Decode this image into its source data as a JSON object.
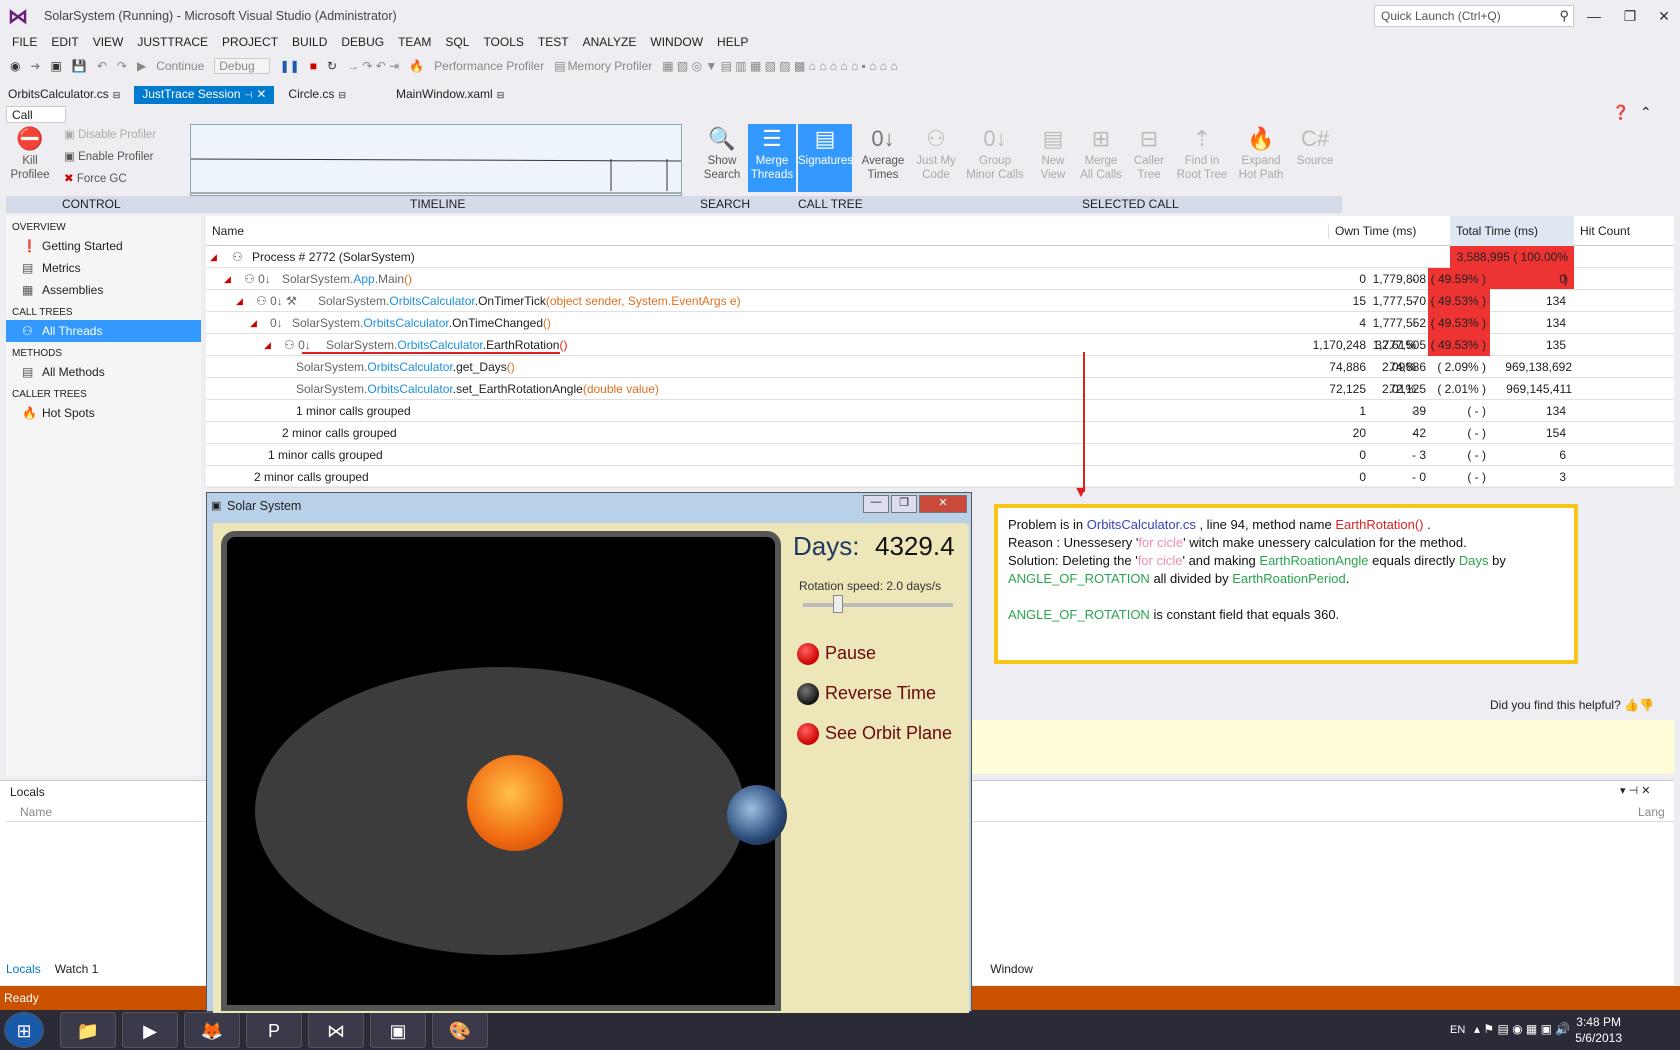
{
  "window": {
    "title": "SolarSystem (Running) - Microsoft Visual Studio (Administrator)",
    "quick_launch": "Quick Launch (Ctrl+Q)"
  },
  "menu": [
    "FILE",
    "EDIT",
    "VIEW",
    "JUSTTRACE",
    "PROJECT",
    "BUILD",
    "DEBUG",
    "TEAM",
    "SQL",
    "TOOLS",
    "TEST",
    "ANALYZE",
    "WINDOW",
    "HELP"
  ],
  "toolbar": {
    "continue": "Continue",
    "config": "Debug",
    "perf_profiler": "Performance Profiler",
    "mem_profiler": "Memory Profiler"
  },
  "tabs": [
    "OrbitsCalculator.cs",
    "JustTrace Session",
    "Circle.cs",
    "MainWindow.xaml"
  ],
  "panel_title": "Call Tree",
  "ribbon": {
    "kill": "Kill Profilee",
    "disable": "Disable Profiler",
    "enable": "Enable Profiler",
    "forcegc": "Force GC",
    "show_search": "Show Search",
    "merge_threads": "Merge Threads",
    "signatures": "Signatures",
    "average_times": "Average Times",
    "just_my_code": "Just My Code",
    "group_minor": "Group Minor Calls",
    "new_view": "New View",
    "merge_all": "Merge All Calls",
    "caller_tree": "Caller Tree",
    "find_root": "Find in Root Tree",
    "expand_hot": "Expand Hot Path",
    "source": "Source",
    "groups": [
      "CONTROL",
      "TIMELINE",
      "SEARCH",
      "CALL TREE",
      "SELECTED CALL"
    ]
  },
  "nav": {
    "overview_h": "OVERVIEW",
    "getting_started": "Getting Started",
    "metrics": "Metrics",
    "assemblies": "Assemblies",
    "calltrees_h": "CALL TREES",
    "all_threads": "All Threads",
    "methods_h": "METHODS",
    "all_methods": "All Methods",
    "callertrees_h": "CALLER TREES",
    "hot_spots": "Hot Spots"
  },
  "grid": {
    "headers": {
      "name": "Name",
      "own": "Own Time (ms)",
      "total": "Total Time (ms)",
      "hits": "Hit Count"
    },
    "rows": [
      {
        "name": "Process  # 2772 (SolarSystem)",
        "own": "",
        "ownp": "",
        "total": "3,588,995",
        "totp": "( 100.00% )",
        "hits": ""
      },
      {
        "name_a": "SolarSystem.",
        "name_b": "App",
        "name_c": ".Main",
        "name_d": "()",
        "own": "0",
        "ownp": "-",
        "total": "1,779,808",
        "totp": "( 49.59% )",
        "hits": "0"
      },
      {
        "name_a": "SolarSystem.",
        "name_b": "OrbitsCalculator",
        "name_c": ".OnTimerTick",
        "name_d": "(object sender, System.EventArgs e)",
        "own": "15",
        "ownp": "-",
        "total": "1,777,570",
        "totp": "( 49.53% )",
        "hits": "134"
      },
      {
        "name_a": "SolarSystem.",
        "name_b": "OrbitsCalculator",
        "name_c": ".OnTimeChanged",
        "name_d": "()",
        "own": "4",
        "ownp": "-",
        "total": "1,777,552",
        "totp": "( 49.53% )",
        "hits": "134"
      },
      {
        "name_a": "SolarSystem.",
        "name_b": "OrbitsCalculator",
        "name_c": ".EarthRotation",
        "name_d": "()",
        "own": "1,170,248",
        "ownp": "32.61%",
        "total": "1,777,505",
        "totp": "( 49.53% )",
        "hits": "135"
      },
      {
        "name_a": "SolarSystem.",
        "name_b": "OrbitsCalculator",
        "name_c": ".get_Days",
        "name_d": "()",
        "own": "74,886",
        "ownp": "2.09%",
        "total": "74,886",
        "totp": "( 2.09% )",
        "hits": "969,138,692"
      },
      {
        "name_a": "SolarSystem.",
        "name_b": "OrbitsCalculator",
        "name_c": ".set_EarthRotationAngle",
        "name_d": "(double value)",
        "own": "72,125",
        "ownp": "2.01%",
        "total": "72,125",
        "totp": "( 2.01% )",
        "hits": "969,145,411"
      },
      {
        "name": "1 minor calls grouped",
        "own": "1",
        "ownp": "-",
        "total": "39",
        "totp": "( - )",
        "hits": "134"
      },
      {
        "name": "2 minor calls grouped",
        "own": "20",
        "ownp": "-",
        "total": "42",
        "totp": "( - )",
        "hits": "154"
      },
      {
        "name": "1 minor calls grouped",
        "own": "0",
        "ownp": "-",
        "total": "3",
        "totp": "( - )",
        "hits": "6"
      },
      {
        "name": "2 minor calls grouped",
        "own": "0",
        "ownp": "-",
        "total": "0",
        "totp": "( - )",
        "hits": "3"
      }
    ]
  },
  "annotation": {
    "l1a": "Problem is in ",
    "l1b": "OrbitsCalculator.cs",
    "l1c": " , line 94, method name ",
    "l1d": "EarthRotation()",
    "l1e": " .",
    "l2a": "Reason : Unessesery '",
    "l2b": "for cicle",
    "l2c": "' witch make unessery calculation for the method.",
    "l3a": "Solution:  Deleting the '",
    "l3b": "for cicle",
    "l3c": "' and making ",
    "l3d": "EarthRoationAngle",
    "l3e": " equals directly ",
    "l3f": "Days",
    "l3g": " by",
    "l4a": "ANGLE_OF_ROTATION",
    "l4b": " all divided by ",
    "l4c": "EarthRoationPeriod",
    "l4d": ".",
    "l5a": "ANGLE_OF_ROTATION",
    "l5b": " is constant field that  equals 360."
  },
  "helpful": "Did you find this helpful?",
  "locals": {
    "title": "Locals",
    "col_name": "Name",
    "col_lang": "Lang",
    "tab_locals": "Locals",
    "tab_watch": "Watch 1",
    "partial": "Window"
  },
  "status": "Ready",
  "solar": {
    "title": "Solar System",
    "days_label": "Days:",
    "days": "4329.4",
    "speed": "Rotation speed: 2.0 days/s",
    "pause": "Pause",
    "reverse": "Reverse Time",
    "orbit": "See Orbit Plane"
  },
  "taskbar": {
    "lang": "EN",
    "time": "3:48 PM",
    "date": "5/6/2013"
  },
  "colors": {
    "accent": "#007acc",
    "status": "#ca5100",
    "highlight": "#ee3333",
    "annotation_border": "#f5c518"
  }
}
